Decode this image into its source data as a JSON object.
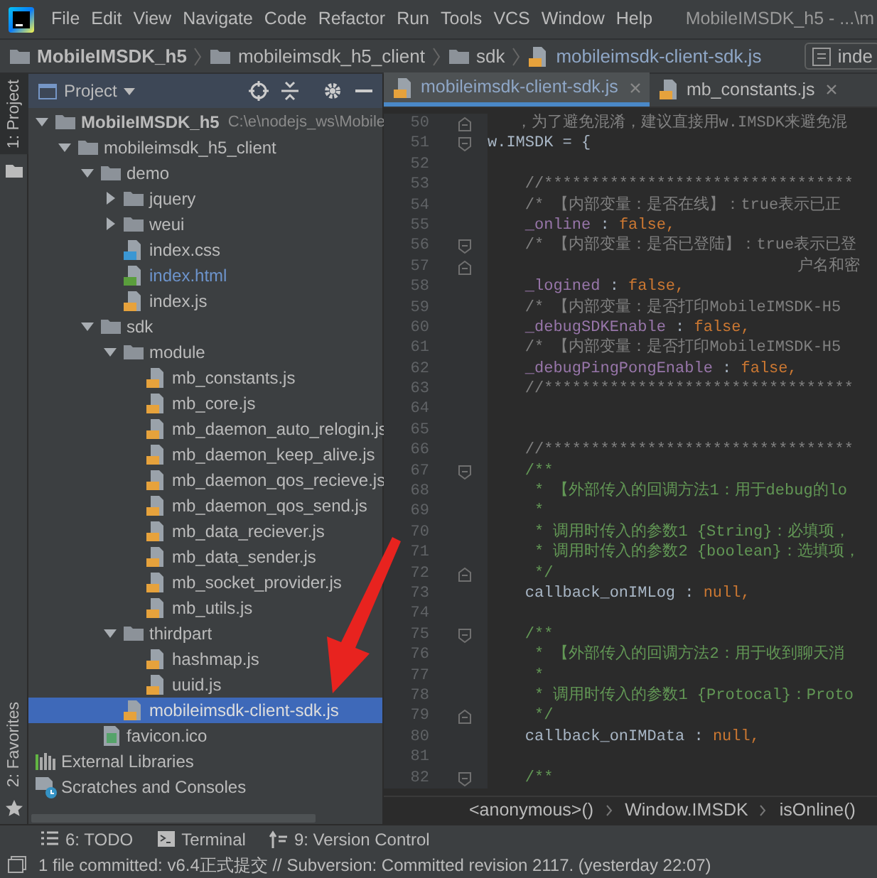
{
  "menu_bar": {
    "items": [
      "File",
      "Edit",
      "View",
      "Navigate",
      "Code",
      "Refactor",
      "Run",
      "Tools",
      "VCS",
      "Window",
      "Help"
    ],
    "title": "MobileIMSDK_h5 - ...\\m"
  },
  "navigation_bar": {
    "crumbs": [
      {
        "label": "MobileIMSDK_h5",
        "kind": "module"
      },
      {
        "label": "mobileimsdk_h5_client",
        "kind": "folder"
      },
      {
        "label": "sdk",
        "kind": "folder"
      },
      {
        "label": "mobileimsdk-client-sdk.js",
        "kind": "js"
      }
    ],
    "run_config": "inde"
  },
  "side_tabs": [
    {
      "label": "1: Project",
      "kind": "project",
      "selected": true
    },
    {
      "label": "2: Favorites",
      "kind": "favorites",
      "selected": false
    }
  ],
  "project_panel": {
    "title": "Project",
    "tree": [
      {
        "label": "MobileIMSDK_h5",
        "kind": "module",
        "path": "C:\\e\\nodejs_ws\\Mobile",
        "expanded": true,
        "selected": false,
        "children": [
          {
            "label": "mobileimsdk_h5_client",
            "kind": "folder",
            "expanded": true,
            "selected": false,
            "children": [
              {
                "label": "demo",
                "kind": "folder",
                "expanded": true,
                "selected": false,
                "children": [
                  {
                    "label": "jquery",
                    "kind": "folder",
                    "expanded": false,
                    "selected": false
                  },
                  {
                    "label": "weui",
                    "kind": "folder",
                    "expanded": false,
                    "selected": false
                  },
                  {
                    "label": "index.css",
                    "kind": "css",
                    "changed": false,
                    "selected": false
                  },
                  {
                    "label": "index.html",
                    "kind": "html",
                    "changed": true,
                    "selected": false
                  },
                  {
                    "label": "index.js",
                    "kind": "js",
                    "changed": false,
                    "selected": false
                  }
                ]
              },
              {
                "label": "sdk",
                "kind": "folder",
                "expanded": true,
                "selected": false,
                "children": [
                  {
                    "label": "module",
                    "kind": "folder",
                    "expanded": true,
                    "selected": false,
                    "children": [
                      {
                        "label": "mb_constants.js",
                        "kind": "js",
                        "changed": false,
                        "selected": false
                      },
                      {
                        "label": "mb_core.js",
                        "kind": "js",
                        "changed": false,
                        "selected": false
                      },
                      {
                        "label": "mb_daemon_auto_relogin.js",
                        "kind": "js",
                        "changed": false,
                        "selected": false
                      },
                      {
                        "label": "mb_daemon_keep_alive.js",
                        "kind": "js",
                        "changed": false,
                        "selected": false
                      },
                      {
                        "label": "mb_daemon_qos_recieve.js",
                        "kind": "js",
                        "changed": false,
                        "selected": false
                      },
                      {
                        "label": "mb_daemon_qos_send.js",
                        "kind": "js",
                        "changed": false,
                        "selected": false
                      },
                      {
                        "label": "mb_data_reciever.js",
                        "kind": "js",
                        "changed": false,
                        "selected": false
                      },
                      {
                        "label": "mb_data_sender.js",
                        "kind": "js",
                        "changed": false,
                        "selected": false
                      },
                      {
                        "label": "mb_socket_provider.js",
                        "kind": "js",
                        "changed": false,
                        "selected": false
                      },
                      {
                        "label": "mb_utils.js",
                        "kind": "js",
                        "changed": false,
                        "selected": false
                      }
                    ]
                  },
                  {
                    "label": "thirdpart",
                    "kind": "folder",
                    "expanded": true,
                    "selected": false,
                    "children": [
                      {
                        "label": "hashmap.js",
                        "kind": "js",
                        "changed": false,
                        "selected": false
                      },
                      {
                        "label": "uuid.js",
                        "kind": "js",
                        "changed": false,
                        "selected": false
                      }
                    ]
                  },
                  {
                    "label": "mobileimsdk-client-sdk.js",
                    "kind": "js",
                    "changed": false,
                    "selected": true
                  }
                ]
              },
              {
                "label": "favicon.ico",
                "kind": "ico",
                "changed": false,
                "selected": false
              }
            ]
          }
        ]
      },
      {
        "label": "External Libraries",
        "kind": "libraries",
        "selected": false
      },
      {
        "label": "Scratches and Consoles",
        "kind": "scratches",
        "selected": false
      }
    ]
  },
  "editor": {
    "tabs": [
      {
        "label": "mobileimsdk-client-sdk.js",
        "selected": true
      },
      {
        "label": "mb_constants.js",
        "selected": false
      }
    ],
    "lines": [
      {
        "number": "50",
        "kind": "fold_end",
        "tokens": [
          {
            "kind": "comment",
            "text": "   ，为了避免混淆，建议直接用w.IMSDK来避免混"
          }
        ]
      },
      {
        "number": "51",
        "kind": "fold_start",
        "tokens": [
          {
            "kind": "plain",
            "text": "w.IMSDK = {"
          }
        ]
      },
      {
        "number": "52"
      },
      {
        "number": "53",
        "tokens": [
          {
            "kind": "comment",
            "text": "    //*********************************"
          }
        ]
      },
      {
        "number": "54",
        "tokens": [
          {
            "kind": "comment",
            "text": "    /* 【内部变量：是否在线】：true表示已正"
          }
        ]
      },
      {
        "number": "55",
        "tokens": [
          {
            "kind": "property",
            "text": "    _online"
          },
          {
            "kind": "plain",
            "text": " : "
          },
          {
            "kind": "keyword",
            "text": "false,"
          }
        ]
      },
      {
        "number": "56",
        "kind": "fold_start",
        "tokens": [
          {
            "kind": "comment",
            "text": "    /* 【内部变量：是否已登陆】：true表示已登"
          }
        ]
      },
      {
        "number": "57",
        "kind": "fold_end",
        "tokens": [
          {
            "kind": "comment",
            "text": "                                 户名和密"
          }
        ]
      },
      {
        "number": "58",
        "tokens": [
          {
            "kind": "property",
            "text": "    _logined"
          },
          {
            "kind": "plain",
            "text": " : "
          },
          {
            "kind": "keyword",
            "text": "false,"
          }
        ]
      },
      {
        "number": "59",
        "tokens": [
          {
            "kind": "comment",
            "text": "    /* 【内部变量：是否打印MobileIMSDK-H5"
          }
        ]
      },
      {
        "number": "60",
        "tokens": [
          {
            "kind": "property",
            "text": "    _debugSDKEnable"
          },
          {
            "kind": "plain",
            "text": " : "
          },
          {
            "kind": "keyword",
            "text": "false,"
          }
        ]
      },
      {
        "number": "61",
        "tokens": [
          {
            "kind": "comment",
            "text": "    /* 【内部变量：是否打印MobileIMSDK-H5"
          }
        ]
      },
      {
        "number": "62",
        "tokens": [
          {
            "kind": "property",
            "text": "    _debugPingPongEnable"
          },
          {
            "kind": "plain",
            "text": " : "
          },
          {
            "kind": "keyword",
            "text": "false,"
          }
        ]
      },
      {
        "number": "63",
        "tokens": [
          {
            "kind": "comment",
            "text": "    //*********************************"
          }
        ]
      },
      {
        "number": "64"
      },
      {
        "number": "65"
      },
      {
        "number": "66",
        "tokens": [
          {
            "kind": "comment",
            "text": "    //*********************************"
          }
        ]
      },
      {
        "number": "67",
        "kind": "fold_start",
        "tokens": [
          {
            "kind": "doc",
            "text": "    /**"
          }
        ]
      },
      {
        "number": "68",
        "tokens": [
          {
            "kind": "doc",
            "text": "     * 【外部传入的回调方法1：用于debug的lo"
          }
        ]
      },
      {
        "number": "69",
        "tokens": [
          {
            "kind": "doc",
            "text": "     *"
          }
        ]
      },
      {
        "number": "70",
        "tokens": [
          {
            "kind": "doc",
            "text": "     * 调用时传入的参数1 {String}：必填项，"
          }
        ]
      },
      {
        "number": "71",
        "tokens": [
          {
            "kind": "doc",
            "text": "     * 调用时传入的参数2 {boolean}：选填项，"
          }
        ]
      },
      {
        "number": "72",
        "kind": "fold_end",
        "tokens": [
          {
            "kind": "doc",
            "text": "     */"
          }
        ]
      },
      {
        "number": "73",
        "tokens": [
          {
            "kind": "plain",
            "text": "    callback_onIMLog : "
          },
          {
            "kind": "keyword",
            "text": "null,"
          }
        ]
      },
      {
        "number": "74"
      },
      {
        "number": "75",
        "kind": "fold_start",
        "tokens": [
          {
            "kind": "doc",
            "text": "    /**"
          }
        ]
      },
      {
        "number": "76",
        "tokens": [
          {
            "kind": "doc",
            "text": "     * 【外部传入的回调方法2：用于收到聊天消"
          }
        ]
      },
      {
        "number": "77",
        "tokens": [
          {
            "kind": "doc",
            "text": "     *"
          }
        ]
      },
      {
        "number": "78",
        "tokens": [
          {
            "kind": "doc",
            "text": "     * 调用时传入的参数1 {Protocal}：Proto"
          }
        ]
      },
      {
        "number": "79",
        "kind": "fold_end",
        "tokens": [
          {
            "kind": "doc",
            "text": "     */"
          }
        ]
      },
      {
        "number": "80",
        "tokens": [
          {
            "kind": "plain",
            "text": "    callback_onIMData : "
          },
          {
            "kind": "keyword",
            "text": "null,"
          }
        ]
      },
      {
        "number": "81"
      },
      {
        "number": "82",
        "kind": "fold_start",
        "tokens": [
          {
            "kind": "doc",
            "text": "    /**"
          }
        ]
      }
    ],
    "breadcrumb": [
      "<anonymous>()",
      "Window.IMSDK",
      "isOnline()"
    ]
  },
  "tool_windows": [
    {
      "label": "6: TODO",
      "kind": "todo"
    },
    {
      "label": "Terminal",
      "kind": "terminal"
    },
    {
      "label": "9: Version Control",
      "kind": "vcs"
    }
  ],
  "status_bar": {
    "text": "1 file committed: v6.4正式提交 // Subversion: Committed revision 2117. (yesterday 22:07)"
  }
}
